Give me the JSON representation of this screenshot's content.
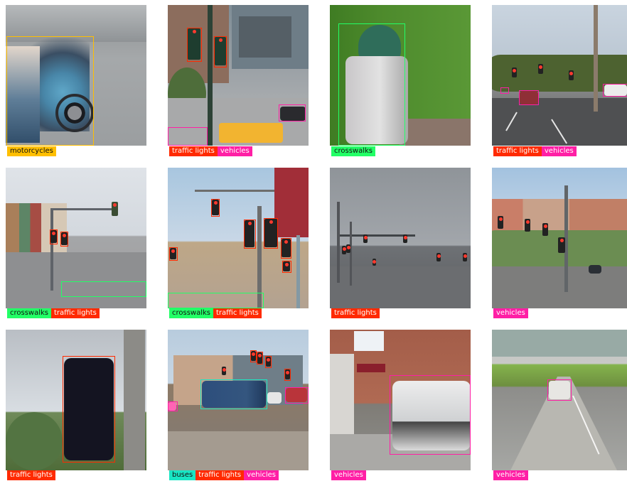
{
  "colors": {
    "motorcycles": "#ffbf00",
    "traffic_lights": "#ff2a00",
    "vehicles": "#ff1fa5",
    "crosswalks": "#22ff66",
    "buses": "#19e6c4"
  },
  "tiles": [
    {
      "labels": [
        "motorcycles"
      ]
    },
    {
      "labels": [
        "traffic lights",
        "vehicles"
      ]
    },
    {
      "labels": [
        "crosswalks"
      ]
    },
    {
      "labels": [
        "traffic lights",
        "vehicles"
      ]
    },
    {
      "labels": [
        "crosswalks",
        "traffic lights"
      ]
    },
    {
      "labels": [
        "crosswalks",
        "traffic lights"
      ]
    },
    {
      "labels": [
        "traffic lights"
      ]
    },
    {
      "labels": [
        "vehicles"
      ]
    },
    {
      "labels": [
        "traffic lights"
      ]
    },
    {
      "labels": [
        "buses",
        "traffic lights",
        "vehicles"
      ]
    },
    {
      "labels": [
        "vehicles"
      ]
    },
    {
      "labels": [
        "vehicles"
      ]
    }
  ]
}
